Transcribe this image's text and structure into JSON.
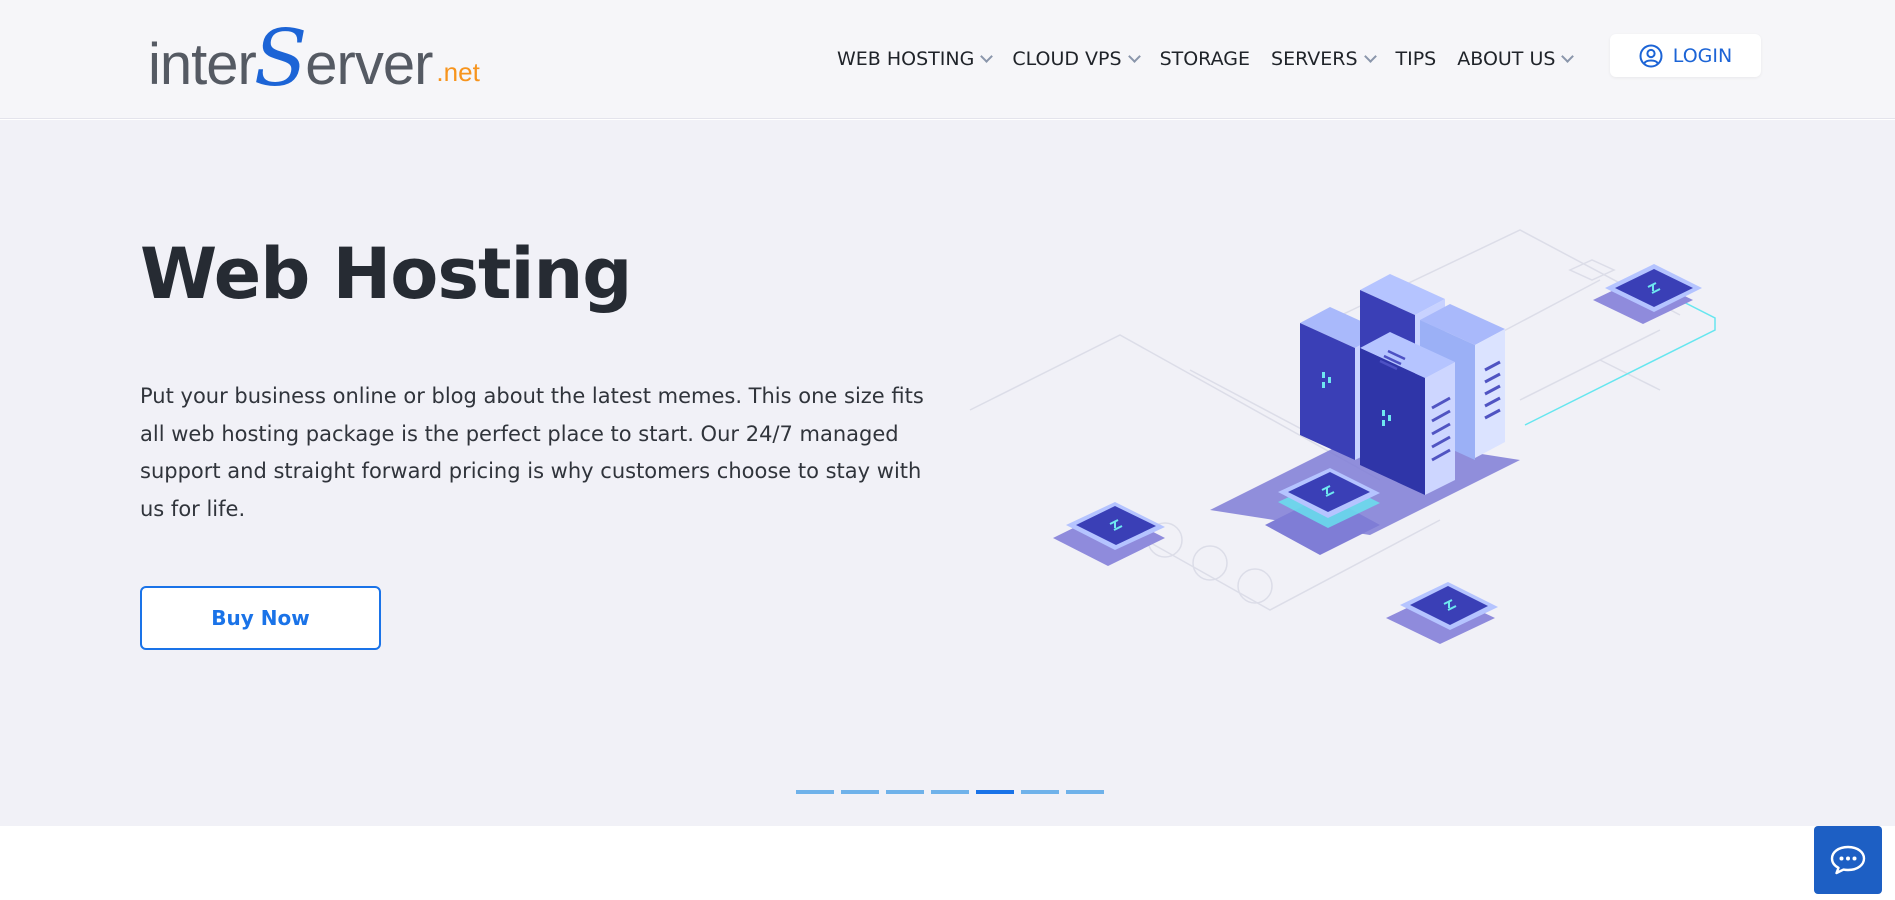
{
  "header": {
    "logo": {
      "part1": "inter",
      "part2": "S",
      "part3": "erver",
      "part4": ".net"
    },
    "nav": [
      {
        "label": "WEB HOSTING",
        "dropdown": true
      },
      {
        "label": "CLOUD VPS",
        "dropdown": true
      },
      {
        "label": "STORAGE",
        "dropdown": false
      },
      {
        "label": "SERVERS",
        "dropdown": true
      },
      {
        "label": "TIPS",
        "dropdown": false
      },
      {
        "label": "ABOUT US",
        "dropdown": true
      }
    ],
    "login_label": "LOGIN"
  },
  "hero": {
    "title": "Web Hosting",
    "description": "Put your business online or blog about the latest memes. This one size fits all web hosting package is the perfect place to start. Our 24/7 managed support and straight forward pricing is why customers choose to stay with us for life.",
    "cta_label": "Buy Now"
  },
  "carousel": {
    "slide_count": 7,
    "active_index": 4
  },
  "colors": {
    "brand_blue": "#1a73e8",
    "logo_orange": "#f7941d",
    "hero_bg": "#f1f1f7",
    "chat_bg": "#1d5fc4"
  },
  "icons": {
    "login": "user-circle-icon",
    "chat": "chat-bubble-icon",
    "dropdown": "chevron-down-icon"
  }
}
